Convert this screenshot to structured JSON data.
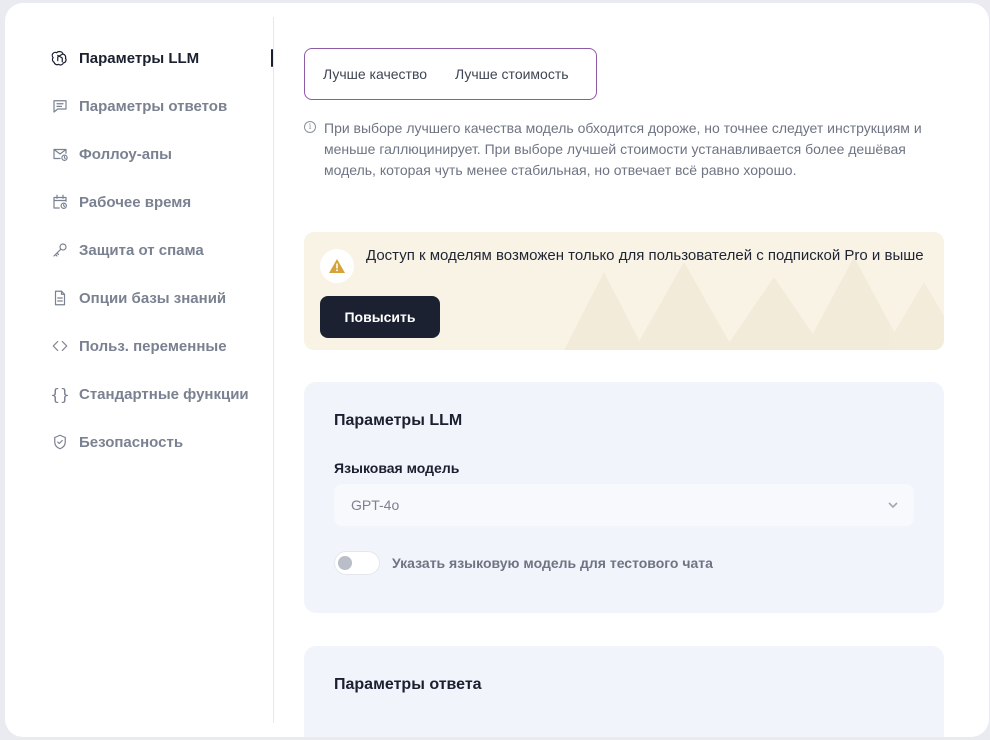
{
  "sidebar": {
    "items": [
      {
        "label": "Параметры LLM",
        "icon": "openai-icon",
        "active": true
      },
      {
        "label": "Параметры ответов",
        "icon": "message-icon"
      },
      {
        "label": "Фоллоу-апы",
        "icon": "mail-clock-icon"
      },
      {
        "label": "Рабочее время",
        "icon": "calendar-clock-icon"
      },
      {
        "label": "Защита от спама",
        "icon": "key-icon"
      },
      {
        "label": "Опции базы знаний",
        "icon": "document-icon"
      },
      {
        "label": "Польз. переменные",
        "icon": "code-brackets-icon"
      },
      {
        "label": "Стандартные функции",
        "icon": "curly-braces-icon"
      },
      {
        "label": "Безопасность",
        "icon": "shield-check-icon"
      }
    ]
  },
  "quality_toggle": {
    "option_quality": "Лучше качество",
    "option_cost": "Лучше стоимость"
  },
  "hint": {
    "icon": "info-icon",
    "text": "При выборе лучшего качества модель обходится дороже, но точнее следует инструкциям и меньше галлюцинирует. При выборе лучшей стоимости устанавливается более дешёвая модель, которая чуть менее стабильная, но отвечает всё равно хорошо."
  },
  "pro_alert": {
    "icon": "warning-icon",
    "text": "Доступ к моделям возможен только для пользователей с подпиской Pro и выше",
    "button_label": "Повысить",
    "background": "#f9f3e6",
    "icon_color": "#d6a23a"
  },
  "llm_card": {
    "title": "Параметры LLM",
    "model_label": "Языковая модель",
    "model_value": "GPT-4o",
    "toggle_label": "Указать языковую модель для тестового чата",
    "toggle_on": false
  },
  "response_card": {
    "title": "Параметры ответа"
  },
  "colors": {
    "accent_border": "#8e5aa6",
    "dark_button": "#1b2130",
    "card_bg": "#f2f4fb"
  }
}
